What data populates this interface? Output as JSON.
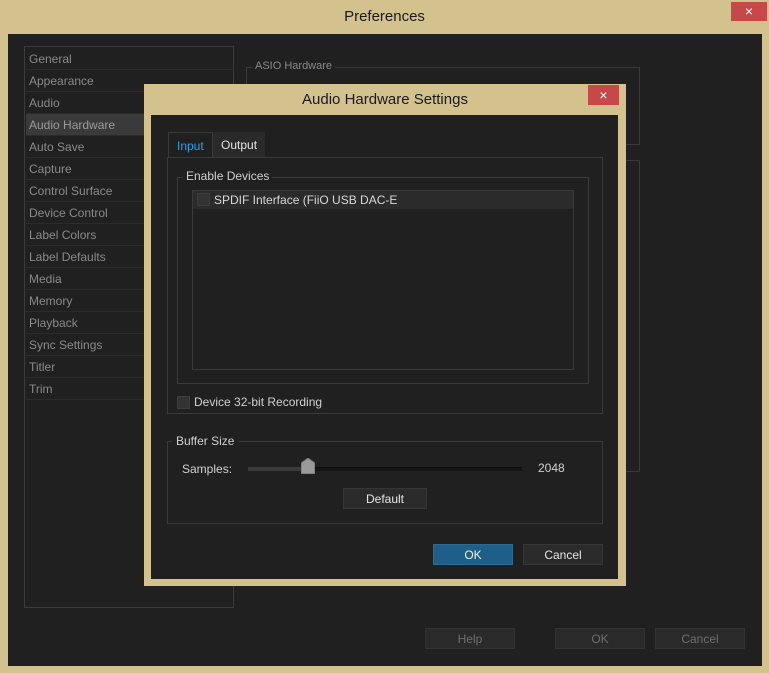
{
  "preferences": {
    "title": "Preferences",
    "close_icon": "×",
    "categories": [
      "General",
      "Appearance",
      "Audio",
      "Audio Hardware",
      "Auto Save",
      "Capture",
      "Control Surface",
      "Device Control",
      "Label Colors",
      "Label Defaults",
      "Media",
      "Memory",
      "Playback",
      "Sync Settings",
      "Titler",
      "Trim"
    ],
    "selected_category": "Audio Hardware",
    "asio_group_label": "ASIO Hardware",
    "buttons": {
      "help": "Help",
      "ok": "OK",
      "cancel": "Cancel"
    }
  },
  "dialog": {
    "title": "Audio Hardware Settings",
    "close_icon": "×",
    "tabs": [
      {
        "label": "Input",
        "active": true
      },
      {
        "label": "Output",
        "active": false
      }
    ],
    "enable_devices_label": "Enable Devices",
    "devices": [
      {
        "name": "SPDIF Interface (FiiO USB DAC-E",
        "checked": false
      }
    ],
    "device_32bit_label": "Device 32-bit Recording",
    "device_32bit_checked": false,
    "buffer_size_label": "Buffer Size",
    "samples_label": "Samples:",
    "samples_value": "2048",
    "slider_position_fraction": 0.22,
    "buttons": {
      "default": "Default",
      "ok": "OK",
      "cancel": "Cancel"
    }
  },
  "colors": {
    "frame": "#d3c18e",
    "panel": "#202020",
    "accent_tab": "#2d9fe6",
    "ok_button": "#1e5f88",
    "close_button": "#c74848"
  }
}
